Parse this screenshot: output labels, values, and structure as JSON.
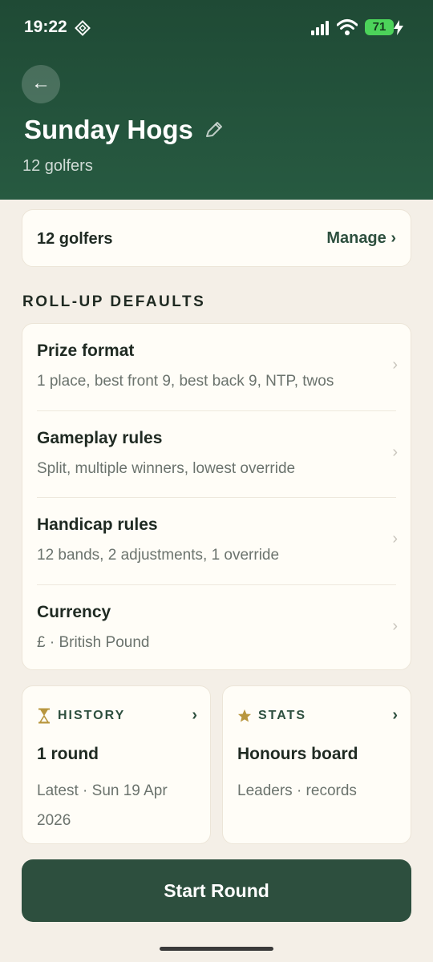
{
  "status_bar": {
    "time": "19:22",
    "battery": "71"
  },
  "header": {
    "title": "Sunday Hogs",
    "subtitle": "12 golfers",
    "back_icon": "←"
  },
  "golfers_card": {
    "count": "12 golfers",
    "manage_label": "Manage ›"
  },
  "defaults": {
    "heading": "ROLL-UP DEFAULTS",
    "items": [
      {
        "title": "Prize format",
        "subtitle": "1 place, best front 9, best back 9, NTP, twos"
      },
      {
        "title": "Gameplay rules",
        "subtitle": "Split, multiple winners, lowest override"
      },
      {
        "title": "Handicap rules",
        "subtitle": "12 bands, 2 adjustments, 1 override"
      },
      {
        "title": "Currency",
        "subtitle": "£ · British Pound"
      }
    ],
    "chevron": "›"
  },
  "tiles": {
    "history": {
      "label": "HISTORY",
      "title": "1 round",
      "subtitle": "Latest · Sun 19 Apr 2026",
      "chevron": "›"
    },
    "stats": {
      "label": "STATS",
      "title": "Honours board",
      "subtitle": "Leaders · records",
      "chevron": "›"
    }
  },
  "start_button": {
    "label": "Start Round"
  },
  "colors": {
    "header": "#1f4a35",
    "accent": "#2d4f3e",
    "gold": "#b8963e",
    "background": "#f4efe7"
  }
}
